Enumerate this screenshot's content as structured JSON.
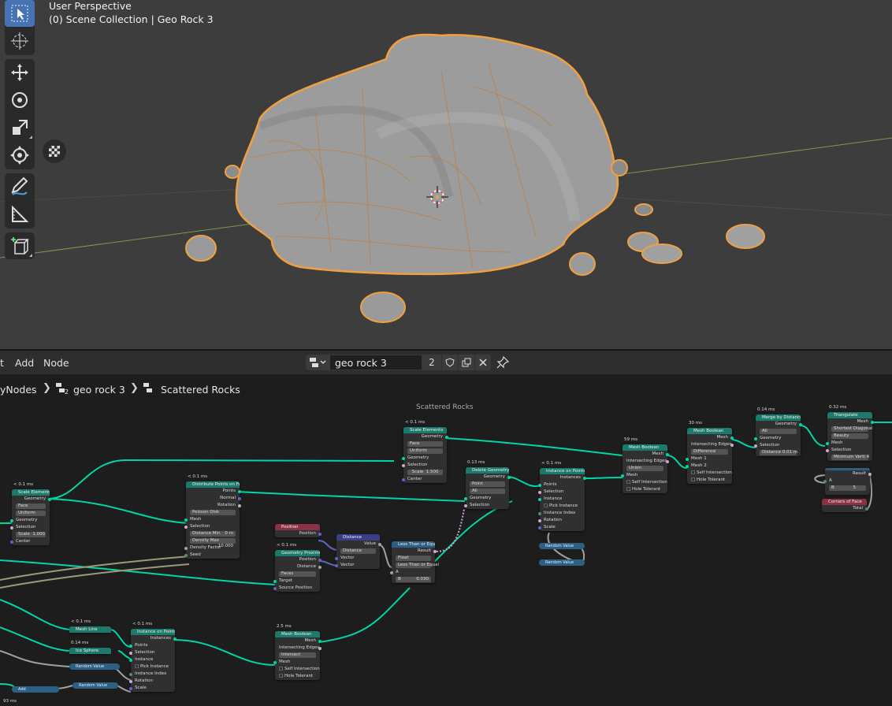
{
  "viewport": {
    "perspective_label": "User Perspective",
    "collection_label": "(0) Scene Collection | Geo Rock 3",
    "tools": [
      "select-box",
      "cursor",
      "move",
      "rotate",
      "scale",
      "transform",
      "annotate",
      "measure",
      "add-cube"
    ]
  },
  "header": {
    "menu": [
      "t",
      "Add",
      "Node"
    ],
    "tree_name": "geo rock 3",
    "users_count": "2"
  },
  "breadcrumb": {
    "items": [
      "yNodes",
      "geo rock 3",
      "Scattered Rocks"
    ],
    "badge": "2"
  },
  "canvas": {
    "frame_title": "Scattered Rocks"
  },
  "nodes": {
    "scale_elements_1": {
      "timing": "< 0.1 ms",
      "title": "Scale Elements",
      "out_geometry": "Geometry",
      "domain": "Face",
      "mode": "Uniform",
      "in_geometry": "Geometry",
      "selection": "Selection",
      "scale_label": "Scale",
      "scale_value": "1.000",
      "center": "Center"
    },
    "distribute": {
      "timing": "< 0.1 ms",
      "title": "Distribute Points on Faces",
      "out_points": "Points",
      "out_normal": "Normal",
      "out_rotation": "Rotation",
      "method": "Poisson Disk",
      "mesh": "Mesh",
      "selection": "Selection",
      "dist_label": "Distance Min",
      "dist_value": "0 m",
      "density_label": "Density Max",
      "density_value": "10.000",
      "density_factor": "Density Factor",
      "seed": "Seed"
    },
    "scale_elements_2": {
      "timing": "< 0.1 ms",
      "title": "Scale Elements",
      "out_geometry": "Geometry",
      "domain": "Face",
      "mode": "Uniform",
      "in_geometry": "Geometry",
      "selection": "Selection",
      "scale_label": "Scale",
      "scale_value": "1.500",
      "center": "Center"
    },
    "delete_geometry": {
      "timing": "0.13 ms",
      "title": "Delete Geometry",
      "out_geometry": "Geometry",
      "domain": "Point",
      "mode": "All",
      "in_geometry": "Geometry",
      "selection": "Selection"
    },
    "instance_on_points_1": {
      "timing": "< 0.1 ms",
      "title": "Instance on Points",
      "out_instances": "Instances",
      "points": "Points",
      "selection": "Selection",
      "instance": "Instance",
      "pick": "Pick Instance",
      "index": "Instance Index",
      "rotation": "Rotation",
      "scale": "Scale"
    },
    "mesh_boolean_1": {
      "timing": "59 ms",
      "title": "Mesh Boolean",
      "out_mesh": "Mesh",
      "out_edges": "Intersecting Edges",
      "operation": "Union",
      "mesh": "Mesh",
      "self": "Self Intersection",
      "hole": "Hole Tolerant"
    },
    "mesh_boolean_2": {
      "timing": "30 ms",
      "title": "Mesh Boolean",
      "out_mesh": "Mesh",
      "out_edges": "Intersecting Edges",
      "operation": "Difference",
      "mesh1": "Mesh 1",
      "mesh2": "Mesh 2",
      "self": "Self Intersection",
      "hole": "Hole Tolerant"
    },
    "merge": {
      "timing": "0.14 ms",
      "title": "Merge by Distance",
      "out_geometry": "Geometry",
      "mode": "All",
      "in_geometry": "Geometry",
      "selection": "Selection",
      "dist_label": "Distance",
      "dist_value": "0.01 m"
    },
    "triangulate": {
      "timing": "0.32 ms",
      "title": "Triangulate",
      "out_mesh": "Mesh",
      "quad": "Shortest Diagonal",
      "ngon": "Beauty",
      "mesh": "Mesh",
      "selection": "Selection",
      "minv": "Minimum Verti 4"
    },
    "compare": {
      "out_result": "Result",
      "a": "A",
      "b_label": "B",
      "b_value": "5"
    },
    "corners": {
      "title": "Corners of Face",
      "total": "Total"
    },
    "position": {
      "title": "Position",
      "out": "Position"
    },
    "geo_proximity": {
      "timing": "< 0.1 ms",
      "title": "Geometry Proximity",
      "out_position": "Position",
      "out_distance": "Distance",
      "mode": "Faces",
      "target": "Target",
      "source": "Source Position"
    },
    "distance": {
      "title": "Distance",
      "out": "Value",
      "mode": "Distance",
      "a": "Vector",
      "b": "Vector"
    },
    "less_than": {
      "title": "Less Than or Equal",
      "out": "Result",
      "type": "Float",
      "mode": "Less Than or Equal",
      "a": "A",
      "b_label": "B",
      "b_value": "0.030"
    },
    "random_1": {
      "title": "Random Value"
    },
    "random_2": {
      "title": "Random Value"
    },
    "mesh_line": {
      "timing": "< 0.1 ms",
      "title": "Mesh Line"
    },
    "ico_sphere": {
      "timing": "0.14 ms",
      "title": "Ico Sphere"
    },
    "random_3": {
      "title": "Random Value"
    },
    "add": {
      "title": "Add"
    },
    "random_4": {
      "title": "Random Value"
    },
    "instance_on_points_2": {
      "timing": "< 0.1 ms",
      "title": "Instance on Points",
      "out_instances": "Instances",
      "points": "Points",
      "selection": "Selection",
      "instance": "Instance",
      "pick": "Pick Instance",
      "index": "Instance Index",
      "rotation": "Rotation",
      "scale": "Scale"
    },
    "mesh_boolean_3": {
      "timing": "2.5 ms",
      "title": "Mesh Boolean",
      "out_mesh": "Mesh",
      "out_edges": "Intersecting Edges",
      "operation": "Intersect",
      "mesh": "Mesh",
      "self": "Self Intersection",
      "hole": "Hole Tolerant"
    },
    "bottom_timing": "93 ms"
  },
  "colors": {
    "viewport_bg": "#3d3d3d",
    "selection_outline": "#f0a040",
    "geometry_link": "#00d6a3",
    "active_tool": "#4772b3"
  }
}
